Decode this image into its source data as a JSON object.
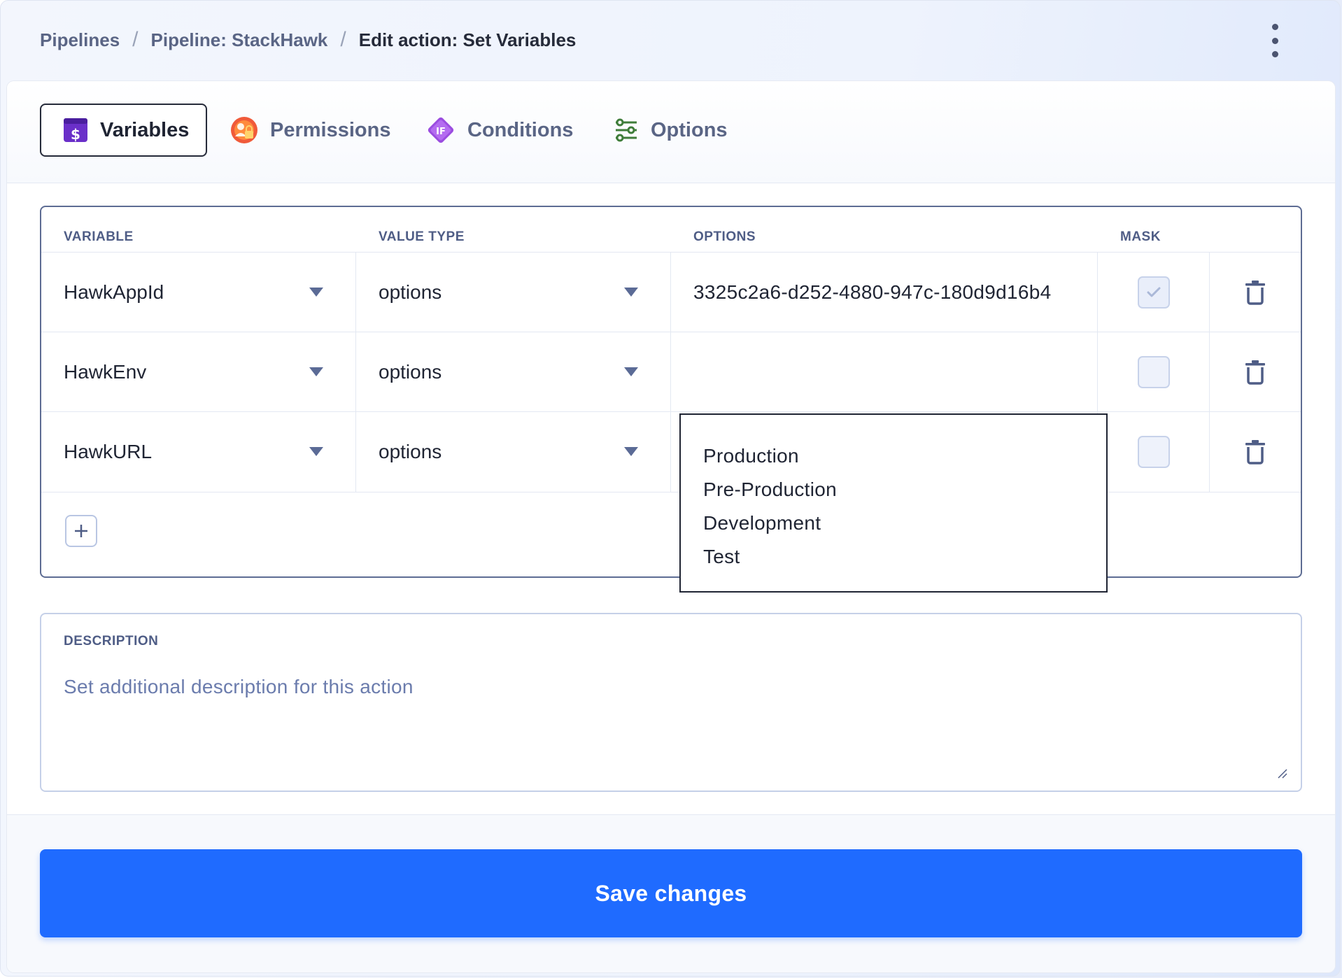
{
  "breadcrumb": {
    "items": [
      "Pipelines",
      "Pipeline: StackHawk"
    ],
    "current": "Edit action: Set Variables",
    "separator": "/"
  },
  "tabs": [
    {
      "label": "Variables",
      "icon": "dollar-box-icon",
      "active": true
    },
    {
      "label": "Permissions",
      "icon": "users-lock-icon",
      "active": false
    },
    {
      "label": "Conditions",
      "icon": "if-diamond-icon",
      "active": false
    },
    {
      "label": "Options",
      "icon": "sliders-icon",
      "active": false
    }
  ],
  "table": {
    "headers": {
      "variable": "VARIABLE",
      "value_type": "VALUE TYPE",
      "options": "OPTIONS",
      "mask": "MASK"
    },
    "rows": [
      {
        "variable": "HawkAppId",
        "value_type": "options",
        "options": "3325c2a6-d252-4880-947c-180d9d16b4",
        "mask": true
      },
      {
        "variable": "HawkEnv",
        "value_type": "options",
        "options": "",
        "mask": false
      },
      {
        "variable": "HawkURL",
        "value_type": "options",
        "options": "",
        "mask": false
      }
    ],
    "options_popup": [
      "Production",
      "Pre-Production",
      "Development",
      "Test"
    ]
  },
  "description": {
    "label": "DESCRIPTION",
    "placeholder": "Set additional description for this action"
  },
  "save_label": "Save changes",
  "colors": {
    "primary": "#1f6bff",
    "text": "#1f2433",
    "muted": "#5a6585"
  }
}
